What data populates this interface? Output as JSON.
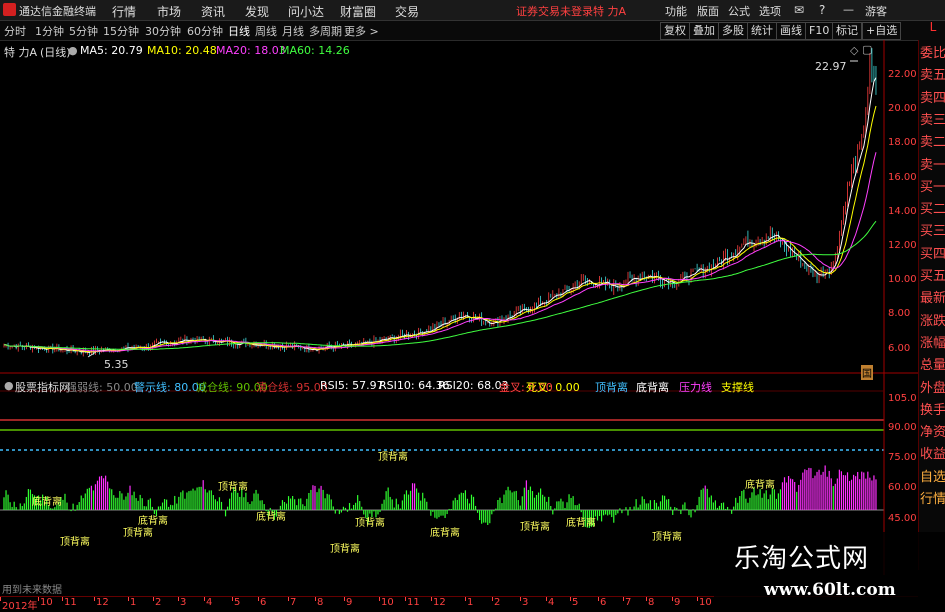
{
  "titlebar": {
    "app_name": "通达信金融终端",
    "menus": [
      "行情",
      "市场",
      "资讯",
      "发现",
      "问小达",
      "财富圈",
      "交易"
    ],
    "warning": "证券交易未登录",
    "stock": "特 力A",
    "right_items": [
      "功能",
      "版面",
      "公式",
      "选项"
    ],
    "guest": "游客"
  },
  "periods": [
    "分时",
    "1分钟",
    "5分钟",
    "15分钟",
    "30分钟",
    "60分钟",
    "日线",
    "周线",
    "月线",
    "多周期",
    "更多 >"
  ],
  "active_period": "日线",
  "toolbar_right": [
    "复权",
    "叠加",
    "多股",
    "统计",
    "画线",
    "F10",
    "标记",
    "+自选"
  ],
  "header": {
    "stock": "特 力A",
    "cycle": "(日线)",
    "ma": [
      {
        "label": "MA5: 20.79",
        "color": "#ffffff"
      },
      {
        "label": "MA10: 20.48",
        "color": "#ffff00"
      },
      {
        "label": "MA20: 18.03",
        "color": "#ff40ff"
      },
      {
        "label": "MA60: 14.26",
        "color": "#40ff40"
      }
    ]
  },
  "price_axis": [
    "22.00",
    "20.00",
    "18.00",
    "16.00",
    "14.00",
    "12.00",
    "10.00",
    "8.00",
    "6.00"
  ],
  "high_label": "22.97",
  "low_label": "5.35",
  "corner_mark": "国",
  "indicator": {
    "name": "股票指标网",
    "items": [
      {
        "label": "强弱线: 50.00",
        "color": "#888888"
      },
      {
        "label": "警示线: 80.00",
        "color": "#40c0ff"
      },
      {
        "label": "减仓线: 90.00",
        "color": "#60c000"
      },
      {
        "label": "清仓线: 95.00",
        "color": "#d03030"
      },
      {
        "label": "RSI5: 57.97",
        "color": "#ffffff"
      },
      {
        "label": "RSI10: 64.36",
        "color": "#ffffff"
      },
      {
        "label": "RSI20: 68.03",
        "color": "#ffffff"
      },
      {
        "label": "金叉: 0.00",
        "color": "#ff4040"
      },
      {
        "label": "死叉: 0.00",
        "color": "#ffff00"
      },
      {
        "label": "顶背离",
        "color": "#40c0ff"
      },
      {
        "label": "底背离",
        "color": "#ffffff"
      },
      {
        "label": "压力线",
        "color": "#ff40ff"
      },
      {
        "label": "支撑线",
        "color": "#ffff00"
      }
    ]
  },
  "ind_axis": [
    "105.0",
    "90.00",
    "75.00",
    "60.00",
    "45.00"
  ],
  "future_note": "用到未来数据",
  "divergence_labels": [
    "底背离",
    "顶背离",
    "顶背离",
    "底背离",
    "顶背离",
    "底背离",
    "顶背离",
    "顶背离",
    "顶背离",
    "底背离",
    "顶背离",
    "底背离",
    "顶背离",
    "底背离"
  ],
  "right_panel": [
    "委比",
    "卖五",
    "卖四",
    "卖三",
    "卖二",
    "卖一",
    "买一",
    "买二",
    "买三",
    "买四",
    "买五",
    "最新",
    "涨跌",
    "涨幅",
    "总量",
    "外盘",
    "换手",
    "净资",
    "收益",
    "自选",
    "行情"
  ],
  "right_panel_top": "L",
  "date_axis": [
    "2012年",
    "10",
    "11",
    "12",
    "1",
    "2",
    "3",
    "4",
    "5",
    "6",
    "7",
    "8",
    "9",
    "10",
    "11",
    "12",
    "1",
    "2",
    "3",
    "4",
    "5",
    "6",
    "7",
    "8",
    "9",
    "10"
  ],
  "watermark": {
    "title": "乐淘公式网",
    "url": "www.60lt.com"
  }
}
